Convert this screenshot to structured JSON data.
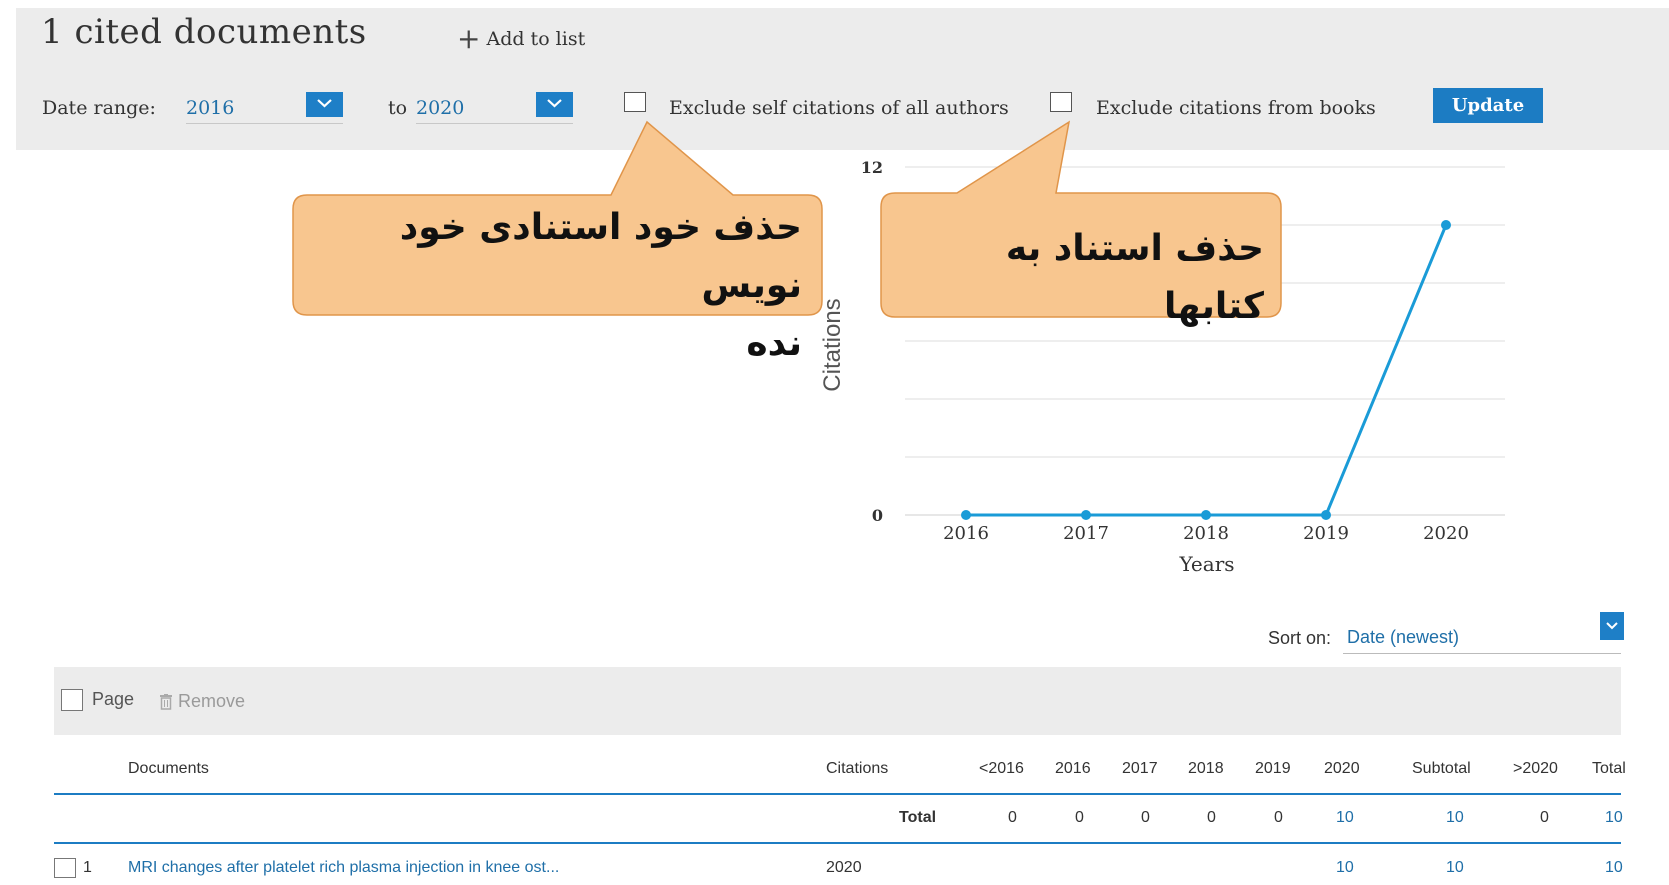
{
  "header": {
    "title": "1 cited documents",
    "add_to_list": "Add to list"
  },
  "filters": {
    "date_range_label": "Date range:",
    "from_year": "2016",
    "to_label": "to",
    "to_year": "2020",
    "exclude_self_label": "Exclude self citations of all authors",
    "exclude_books_label": "Exclude citations from books",
    "update_label": "Update"
  },
  "callouts": {
    "self_citation_line1": "حذف خود استنادی خود نویس",
    "self_citation_line2": "نده",
    "books": "حذف استناد به کتابها",
    "fill_color": "#f8c68f",
    "border_color": "#e0954a"
  },
  "chart_data": {
    "type": "line",
    "x": [
      "2016",
      "2017",
      "2018",
      "2019",
      "2020"
    ],
    "y": [
      0,
      0,
      0,
      0,
      10
    ],
    "ylabel": "Citations",
    "xlabel": "Years",
    "y_ticks_labeled": [
      "0",
      "12"
    ],
    "ylim": [
      0,
      12
    ],
    "grid": true,
    "line_color": "#1a9bd7"
  },
  "sort": {
    "label": "Sort on:",
    "value": "Date (newest)"
  },
  "toolbar": {
    "page_label": "Page",
    "remove_label": "Remove"
  },
  "table": {
    "headers": {
      "documents": "Documents",
      "citations": "Citations",
      "lt2016": "<2016",
      "y2016": "2016",
      "y2017": "2017",
      "y2018": "2018",
      "y2019": "2019",
      "y2020": "2020",
      "subtotal": "Subtotal",
      "gt2020": ">2020",
      "total": "Total"
    },
    "total_row": {
      "label": "Total",
      "lt2016": "0",
      "y2016": "0",
      "y2017": "0",
      "y2018": "0",
      "y2019": "0",
      "y2020": "10",
      "subtotal": "10",
      "gt2020": "0",
      "total": "10"
    },
    "rows": [
      {
        "index": "1",
        "title": "MRI changes after platelet rich plasma injection in knee ost...",
        "year": "2020",
        "y2020": "10",
        "subtotal": "10",
        "total": "10"
      }
    ]
  },
  "colors": {
    "accent": "#1c7cc3",
    "panel_bg": "#ececec",
    "link": "#1f6fa8"
  }
}
